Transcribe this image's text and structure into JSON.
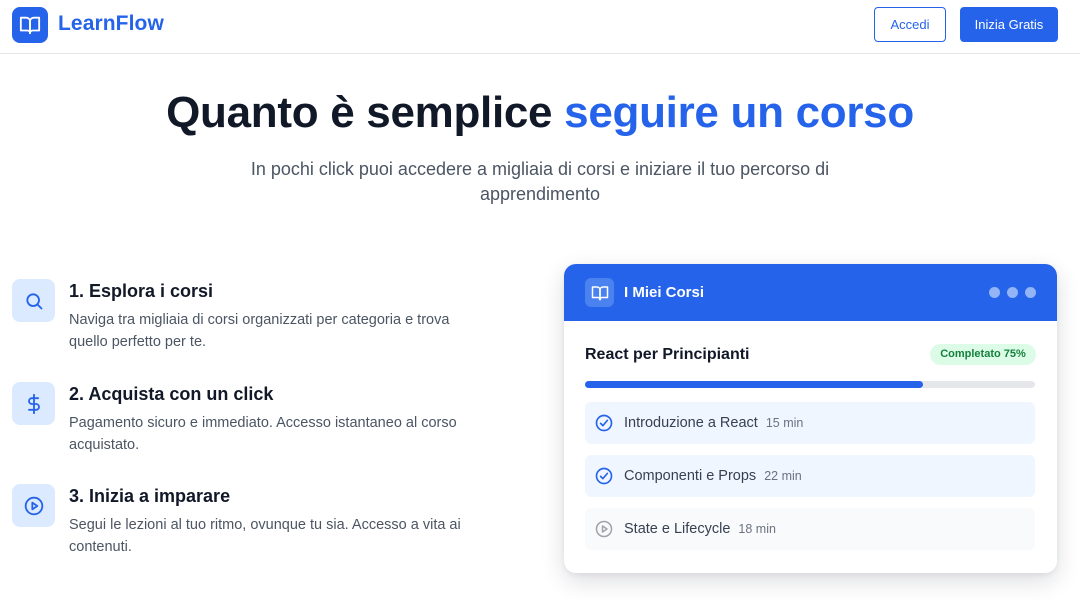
{
  "header": {
    "brand": "LearnFlow",
    "login_label": "Accedi",
    "signup_label": "Inizia Gratis",
    "logo_icon": "book-open-icon",
    "brand_color": "#2563eb"
  },
  "hero": {
    "title_plain": "Quanto è semplice ",
    "title_accent": "seguire un corso",
    "subtitle": "In pochi click puoi accedere a migliaia di corsi e iniziare il tuo percorso di apprendimento"
  },
  "steps": [
    {
      "title": "1. Esplora i corsi",
      "description": "Naviga tra migliaia di corsi organizzati per categoria e trova quello perfetto per te.",
      "icon": "search-icon"
    },
    {
      "title": "2. Acquista con un click",
      "description": "Pagamento sicuro e immediato. Accesso istantaneo al corso acquistato.",
      "icon": "dollar-icon"
    },
    {
      "title": "3. Inizia a imparare",
      "description": "Segui le lezioni al tuo ritmo, ovunque tu sia. Accesso a vita ai contenuti.",
      "icon": "play-circle-icon"
    }
  ],
  "card": {
    "title": "I Miei Corsi",
    "icon": "book-open-icon",
    "course": {
      "title": "React per Principianti",
      "badge": "Completato 75%",
      "progress": 0.75
    },
    "lessons": [
      {
        "title": "Introduzione a React",
        "duration": "15 min",
        "status": "completed",
        "icon": "check-circle-icon"
      },
      {
        "title": "Componenti e Props",
        "duration": "22 min",
        "status": "completed",
        "icon": "check-circle-icon"
      },
      {
        "title": "State e Lifecycle",
        "duration": "18 min",
        "status": "pending",
        "icon": "play-circle-icon"
      }
    ]
  }
}
